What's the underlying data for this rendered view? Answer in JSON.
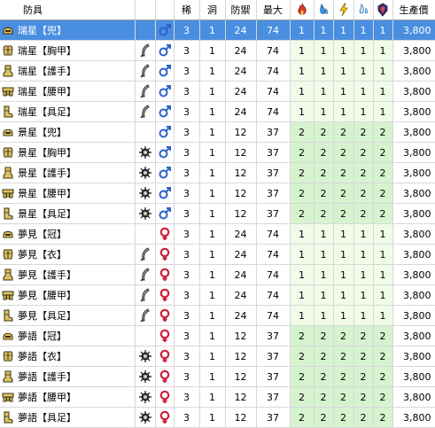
{
  "header": {
    "name": "防具",
    "rarity": "稀",
    "slots": "洞",
    "defense": "防禦",
    "max": "最大",
    "fire_icon": "fire-icon",
    "water_icon": "water-icon",
    "thunder_icon": "thunder-icon",
    "ice_icon": "ice-icon",
    "dragon_icon": "dragon-icon",
    "cost": "生產價"
  },
  "rows": [
    {
      "name": "瑞星【兜】",
      "part": "helm",
      "w1": "",
      "gender": "male",
      "rarity": "3",
      "slots": "1",
      "def": "24",
      "max": "74",
      "r": [
        "1",
        "1",
        "1",
        "1",
        "1"
      ],
      "cost": "3,800",
      "selected": true,
      "green": "light"
    },
    {
      "name": "瑞星【胸甲】",
      "part": "chest",
      "w1": "blade",
      "gender": "male",
      "rarity": "3",
      "slots": "1",
      "def": "24",
      "max": "74",
      "r": [
        "1",
        "1",
        "1",
        "1",
        "1"
      ],
      "cost": "3,800",
      "green": "light"
    },
    {
      "name": "瑞星【護手】",
      "part": "arms",
      "w1": "blade",
      "gender": "male",
      "rarity": "3",
      "slots": "1",
      "def": "24",
      "max": "74",
      "r": [
        "1",
        "1",
        "1",
        "1",
        "1"
      ],
      "cost": "3,800",
      "green": "light"
    },
    {
      "name": "瑞星【腰甲】",
      "part": "waist",
      "w1": "blade",
      "gender": "male",
      "rarity": "3",
      "slots": "1",
      "def": "24",
      "max": "74",
      "r": [
        "1",
        "1",
        "1",
        "1",
        "1"
      ],
      "cost": "3,800",
      "green": "light"
    },
    {
      "name": "瑞星【具足】",
      "part": "legs",
      "w1": "blade",
      "gender": "male",
      "rarity": "3",
      "slots": "1",
      "def": "24",
      "max": "74",
      "r": [
        "1",
        "1",
        "1",
        "1",
        "1"
      ],
      "cost": "3,800",
      "green": "light"
    },
    {
      "name": "景星【兜】",
      "part": "helm",
      "w1": "",
      "gender": "male",
      "rarity": "3",
      "slots": "1",
      "def": "12",
      "max": "37",
      "r": [
        "2",
        "2",
        "2",
        "2",
        "2"
      ],
      "cost": "3,800",
      "green": "dark"
    },
    {
      "name": "景星【胸甲】",
      "part": "chest",
      "w1": "gun",
      "gender": "male",
      "rarity": "3",
      "slots": "1",
      "def": "12",
      "max": "37",
      "r": [
        "2",
        "2",
        "2",
        "2",
        "2"
      ],
      "cost": "3,800",
      "green": "dark"
    },
    {
      "name": "景星【護手】",
      "part": "arms",
      "w1": "gun",
      "gender": "male",
      "rarity": "3",
      "slots": "1",
      "def": "12",
      "max": "37",
      "r": [
        "2",
        "2",
        "2",
        "2",
        "2"
      ],
      "cost": "3,800",
      "green": "dark"
    },
    {
      "name": "景星【腰甲】",
      "part": "waist",
      "w1": "gun",
      "gender": "male",
      "rarity": "3",
      "slots": "1",
      "def": "12",
      "max": "37",
      "r": [
        "2",
        "2",
        "2",
        "2",
        "2"
      ],
      "cost": "3,800",
      "green": "dark"
    },
    {
      "name": "景星【具足】",
      "part": "legs",
      "w1": "gun",
      "gender": "male",
      "rarity": "3",
      "slots": "1",
      "def": "12",
      "max": "37",
      "r": [
        "2",
        "2",
        "2",
        "2",
        "2"
      ],
      "cost": "3,800",
      "green": "dark"
    },
    {
      "name": "夢見【冠】",
      "part": "helm",
      "w1": "",
      "gender": "female",
      "rarity": "3",
      "slots": "1",
      "def": "24",
      "max": "74",
      "r": [
        "1",
        "1",
        "1",
        "1",
        "1"
      ],
      "cost": "3,800",
      "green": "light"
    },
    {
      "name": "夢見【衣】",
      "part": "chest",
      "w1": "blade",
      "gender": "female",
      "rarity": "3",
      "slots": "1",
      "def": "24",
      "max": "74",
      "r": [
        "1",
        "1",
        "1",
        "1",
        "1"
      ],
      "cost": "3,800",
      "green": "light"
    },
    {
      "name": "夢見【護手】",
      "part": "arms",
      "w1": "blade",
      "gender": "female",
      "rarity": "3",
      "slots": "1",
      "def": "24",
      "max": "74",
      "r": [
        "1",
        "1",
        "1",
        "1",
        "1"
      ],
      "cost": "3,800",
      "green": "light"
    },
    {
      "name": "夢見【腰甲】",
      "part": "waist",
      "w1": "blade",
      "gender": "female",
      "rarity": "3",
      "slots": "1",
      "def": "24",
      "max": "74",
      "r": [
        "1",
        "1",
        "1",
        "1",
        "1"
      ],
      "cost": "3,800",
      "green": "light"
    },
    {
      "name": "夢見【具足】",
      "part": "legs",
      "w1": "blade",
      "gender": "female",
      "rarity": "3",
      "slots": "1",
      "def": "24",
      "max": "74",
      "r": [
        "1",
        "1",
        "1",
        "1",
        "1"
      ],
      "cost": "3,800",
      "green": "light"
    },
    {
      "name": "夢語【冠】",
      "part": "helm",
      "w1": "",
      "gender": "female",
      "rarity": "3",
      "slots": "1",
      "def": "12",
      "max": "37",
      "r": [
        "2",
        "2",
        "2",
        "2",
        "2"
      ],
      "cost": "3,800",
      "green": "dark"
    },
    {
      "name": "夢語【衣】",
      "part": "chest",
      "w1": "gun",
      "gender": "female",
      "rarity": "3",
      "slots": "1",
      "def": "12",
      "max": "37",
      "r": [
        "2",
        "2",
        "2",
        "2",
        "2"
      ],
      "cost": "3,800",
      "green": "dark"
    },
    {
      "name": "夢語【護手】",
      "part": "arms",
      "w1": "gun",
      "gender": "female",
      "rarity": "3",
      "slots": "1",
      "def": "12",
      "max": "37",
      "r": [
        "2",
        "2",
        "2",
        "2",
        "2"
      ],
      "cost": "3,800",
      "green": "dark"
    },
    {
      "name": "夢語【腰甲】",
      "part": "waist",
      "w1": "gun",
      "gender": "female",
      "rarity": "3",
      "slots": "1",
      "def": "12",
      "max": "37",
      "r": [
        "2",
        "2",
        "2",
        "2",
        "2"
      ],
      "cost": "3,800",
      "green": "dark"
    },
    {
      "name": "夢語【具足】",
      "part": "legs",
      "w1": "gun",
      "gender": "female",
      "rarity": "3",
      "slots": "1",
      "def": "12",
      "max": "37",
      "r": [
        "2",
        "2",
        "2",
        "2",
        "2"
      ],
      "cost": "3,800",
      "green": "dark"
    }
  ],
  "colors": {
    "selected_row_bg": "#4a8ee0",
    "res_light_bg": "#f0fbe8",
    "res_dark_bg": "#d6f3d0",
    "male_symbol": "#2a63c9",
    "female_symbol": "#cc1f3a"
  }
}
